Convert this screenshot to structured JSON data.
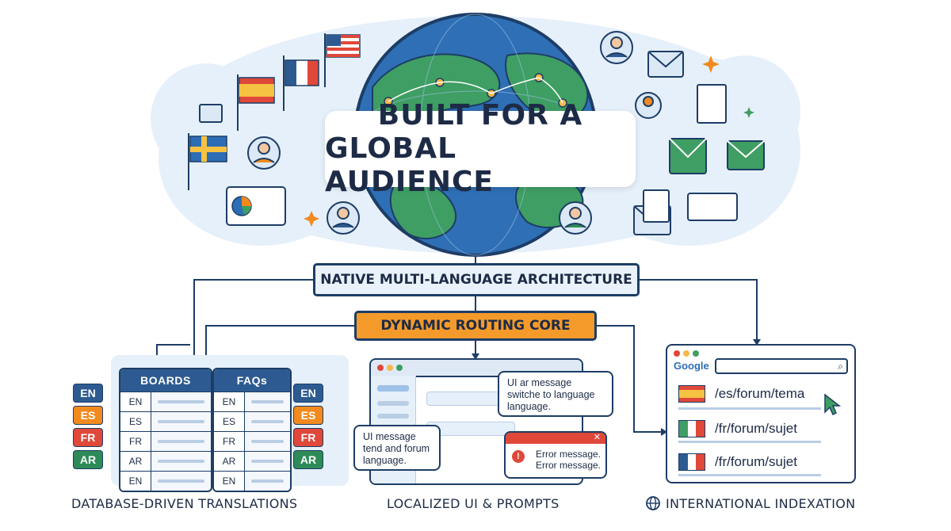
{
  "title": {
    "line1": "BUILT FOR A",
    "line2": "GLOBAL AUDIENCE"
  },
  "banners": {
    "native": "NATIVE MULTI-LANGUAGE ARCHITECTURE",
    "routing": "DYNAMIC ROUTING CORE"
  },
  "database": {
    "boards_header": "BOARDS",
    "faqs_header": "FAQs",
    "boards_rows": [
      "EN",
      "ES",
      "FR",
      "AR",
      "EN"
    ],
    "faqs_rows": [
      "EN",
      "ES",
      "FR",
      "AR",
      "EN"
    ],
    "left_tags": [
      "EN",
      "ES",
      "FR",
      "AR"
    ],
    "right_tags": [
      "EN",
      "ES",
      "FR",
      "AR"
    ],
    "tag_colors": [
      "#2d5b91",
      "#f28a1e",
      "#e0483a",
      "#2e8b57"
    ]
  },
  "localized_ui": {
    "bubble_top": "UI ar message switche to language language.",
    "bubble_left": "UI message tend and forum language.",
    "error_lines": [
      "Error message.",
      "Error message."
    ],
    "error_close": "✕",
    "error_icon": "!"
  },
  "indexation": {
    "search_brand": "Google",
    "urls": [
      "/es/forum/tema",
      "/fr/forum/sujet",
      "/fr/forum/sujet"
    ]
  },
  "footer": {
    "database": "DATABASE-DRIVEN TRANSLATIONS",
    "localized": "LOCALIZED UI & PROMPTS",
    "indexation": "INTERNATIONAL INDEXATION"
  },
  "colors": {
    "navy": "#1d3d66",
    "orange": "#f49a2a",
    "globe_ocean": "#2f6fb5",
    "globe_land": "#3f9e63"
  },
  "icons": [
    "globe-icon",
    "flag-us-icon",
    "flag-france-icon",
    "flag-spain-icon",
    "flag-sweden-icon",
    "user-avatar-icon",
    "email-icon",
    "document-icon",
    "chat-icon",
    "sparkle-icon",
    "search-icon",
    "cursor-icon",
    "world-icon"
  ]
}
